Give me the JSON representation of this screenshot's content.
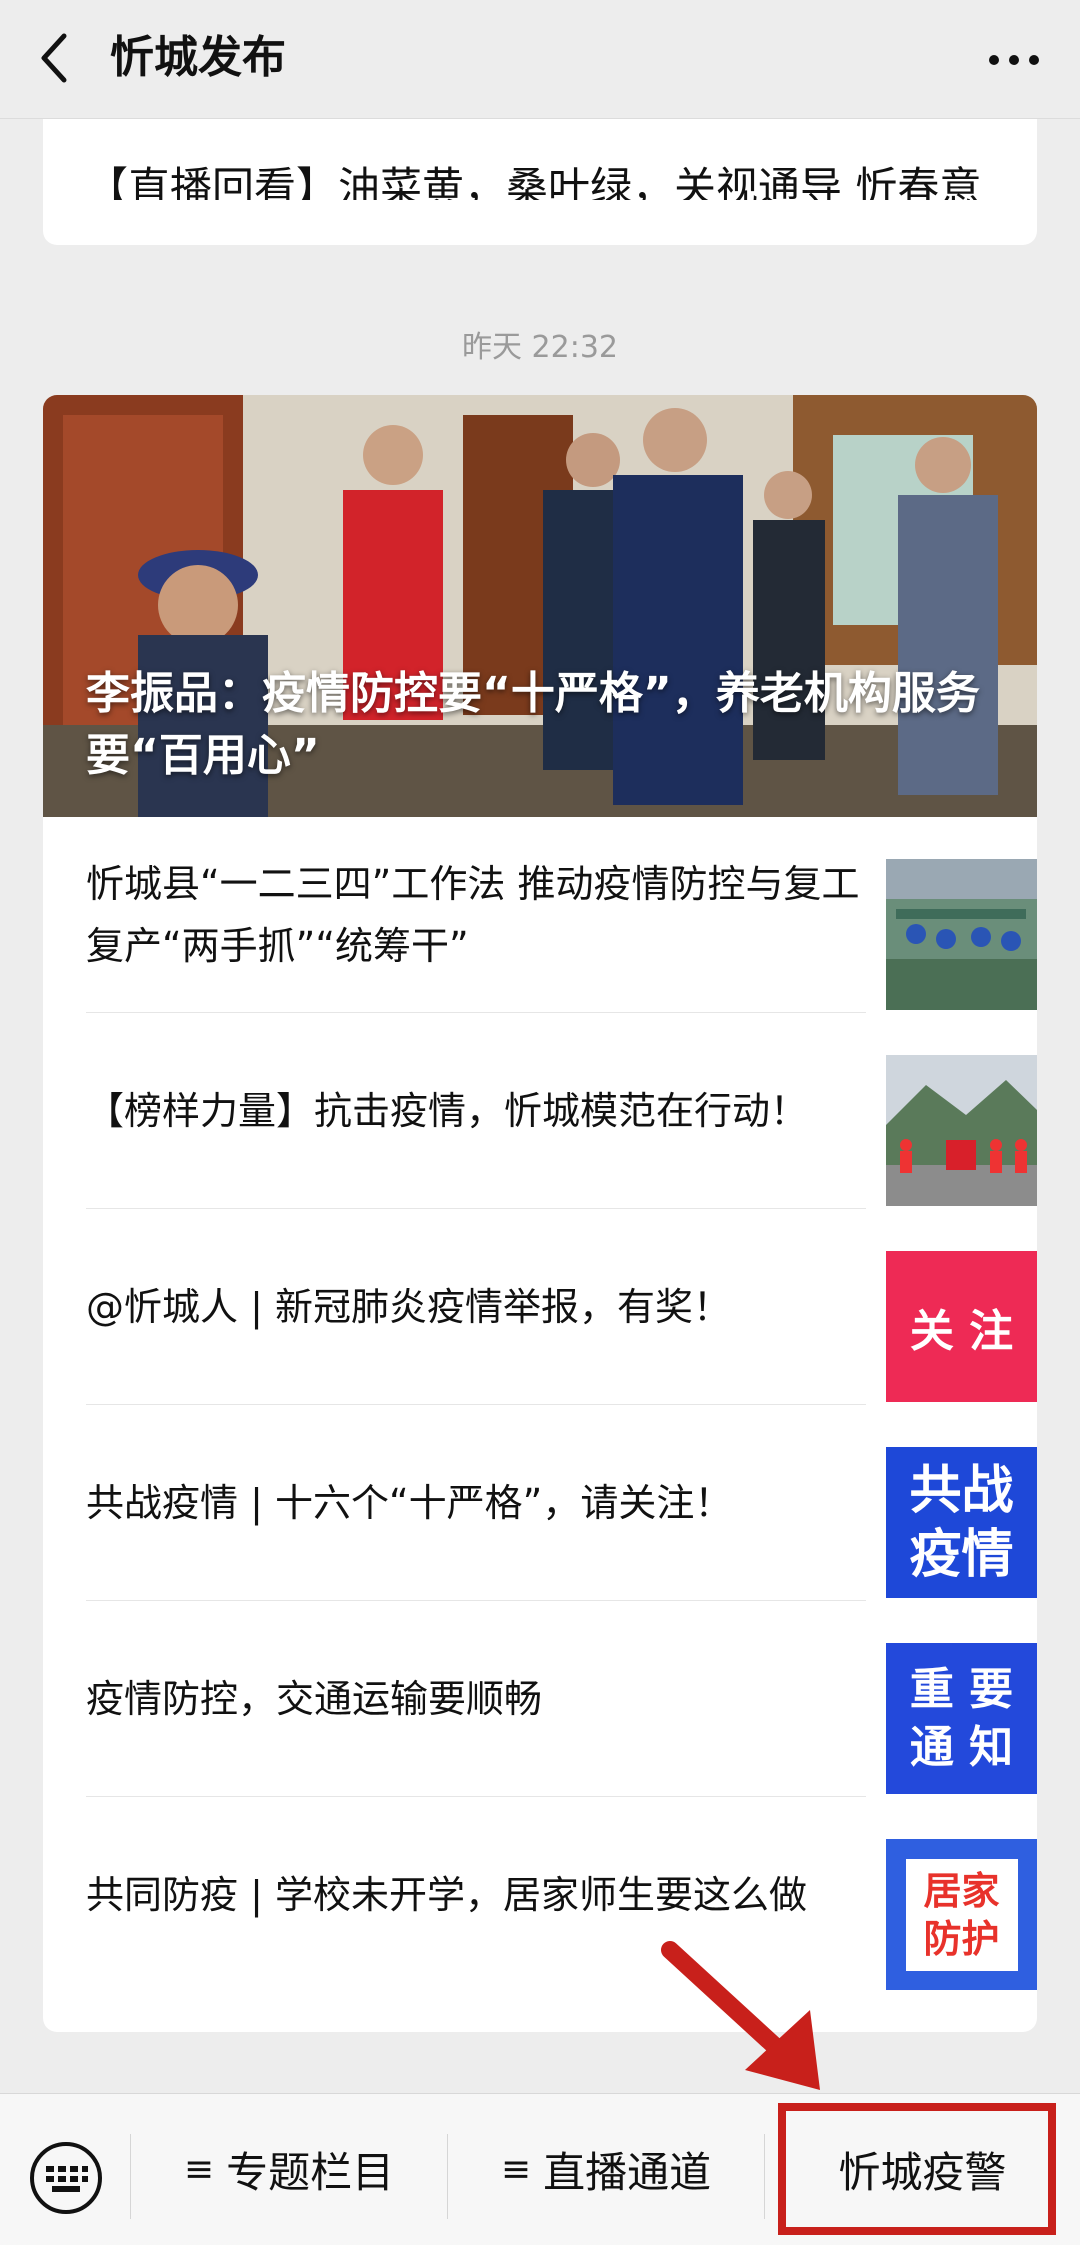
{
  "header": {
    "title": "忻城发布"
  },
  "previous_article": {
    "title": "【直播回看】油菜黄，桑叶绿，关视通导 忻春意"
  },
  "timestamp": "昨天 22:32",
  "hero": {
    "title": "李振品：疫情防控要“十严格”，养老机构服务要“百用心”"
  },
  "articles": [
    {
      "title": "忻城县“一二三四”工作法 推动疫情防控与复工复产“两手抓”“统筹干”",
      "thumb": "factory-photo"
    },
    {
      "title": "【榜样力量】抗击疫情，忻城模范在行动！",
      "thumb": "volunteers-photo"
    },
    {
      "title": "@忻城人 | 新冠肺炎疫情举报，有奖！",
      "thumb_text": "关 注",
      "thumb_color": "#ee2a55"
    },
    {
      "title": "共战疫情 | 十六个“十严格”，请关注！",
      "thumb_text_1": "共战",
      "thumb_text_2": "疫情",
      "thumb_color": "#1e48d8"
    },
    {
      "title": "疫情防控，交通运输要顺畅",
      "thumb_text_1": "重 要",
      "thumb_text_2": "通 知",
      "thumb_color": "#2349db"
    },
    {
      "title": "共同防疫 | 学校未开学，居家师生要这么做",
      "thumb_text_1": "居家",
      "thumb_text_2": "防护",
      "thumb_color": "#2f5fe0"
    }
  ],
  "menu": {
    "item1": "专题栏目",
    "item2": "直播通道",
    "item3": "忻城疫警",
    "menu_symbol": "≡"
  },
  "colors": {
    "highlight": "#c8201b",
    "background": "#ededed"
  }
}
